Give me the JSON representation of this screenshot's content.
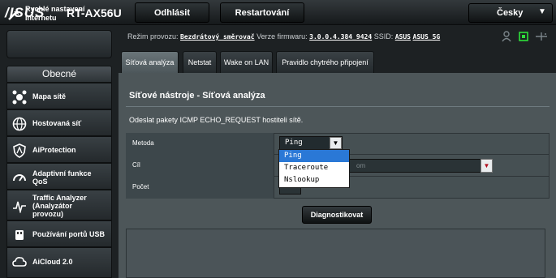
{
  "header": {
    "brand": "/ISUS",
    "model": "RT-AX56U",
    "logout": "Odhlásit",
    "restart": "Restartování",
    "language": "Česky"
  },
  "sidebar": {
    "quick_setup": [
      "Rychlé nastavení",
      "internetu"
    ],
    "section": "Obecné",
    "items": [
      {
        "lines": [
          "Mapa sítě"
        ],
        "icon": "network-map-icon"
      },
      {
        "lines": [
          "Hostovaná síť"
        ],
        "icon": "globe-icon"
      },
      {
        "lines": [
          "AiProtection"
        ],
        "icon": "shield-icon"
      },
      {
        "lines": [
          "Adaptivní funkce",
          "QoS"
        ],
        "icon": "qos-gauge-icon"
      },
      {
        "lines": [
          "Traffic Analyzer",
          "(Analyzátor",
          "provozu)"
        ],
        "icon": "traffic-chart-icon"
      },
      {
        "lines": [
          "Používání portů USB"
        ],
        "icon": "usb-icon"
      },
      {
        "lines": [
          "AiCloud 2.0"
        ],
        "icon": "cloud-icon"
      }
    ]
  },
  "status": {
    "mode_label": "Režim provozu:",
    "mode_value": "Bezdrátový směrovač",
    "fw_label": "Verze firmwaru:",
    "fw_value": "3.0.0.4.384_9424",
    "ssid_label": "SSID:",
    "ssid_1": "ASUS",
    "ssid_2": "ASUS_5G"
  },
  "tabs": [
    "Síťová analýza",
    "Netstat",
    "Wake on LAN",
    "Pravidlo chytrého připojení"
  ],
  "panel": {
    "title": "Síťové nástroje - Síťová analýza",
    "description": "Odeslat pakety ICMP ECHO_REQUEST hostiteli sítě.",
    "method_label": "Metoda",
    "method_value": "Ping",
    "target_label": "Cíl",
    "target_value": "om",
    "count_label": "Počet",
    "options": [
      "Ping",
      "Traceroute",
      "Nslookup"
    ],
    "diagnose": "Diagnostikovat"
  },
  "colors": {
    "background": "#1d2123",
    "panel": "#4d5659",
    "highlight": "#2a78d6",
    "accent_red": "#b10d1e"
  }
}
